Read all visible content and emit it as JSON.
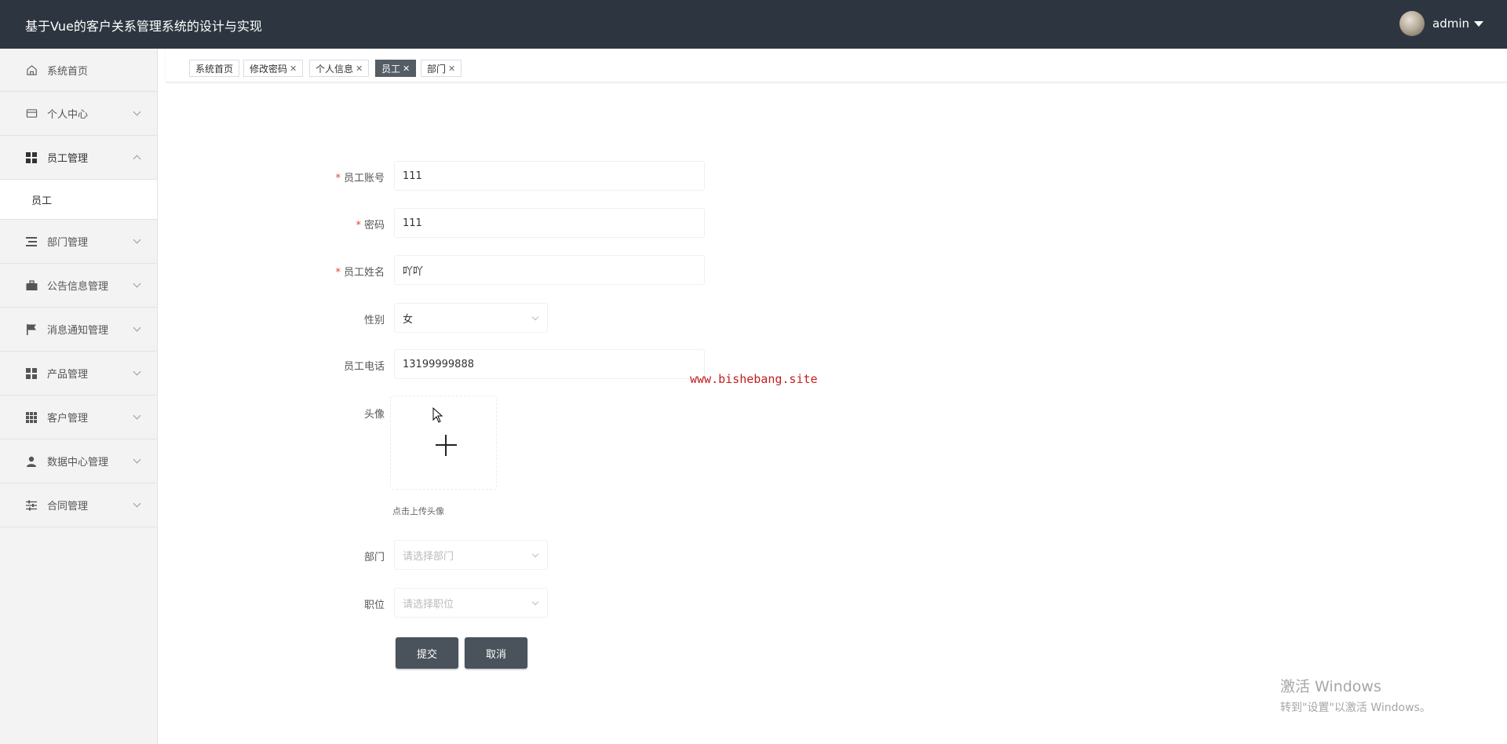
{
  "header": {
    "title": "基于Vue的客户关系管理系统的设计与实现",
    "username": "admin"
  },
  "sidebar": {
    "items": [
      {
        "label": "系统首页",
        "icon": "home-icon"
      },
      {
        "label": "个人中心",
        "icon": "wallet-icon"
      },
      {
        "label": "员工管理",
        "icon": "grid-icon",
        "expanded": true,
        "children": [
          "员工"
        ]
      },
      {
        "label": "部门管理",
        "icon": "list-icon"
      },
      {
        "label": "公告信息管理",
        "icon": "briefcase-icon"
      },
      {
        "label": "消息通知管理",
        "icon": "flag-icon"
      },
      {
        "label": "产品管理",
        "icon": "grid-icon"
      },
      {
        "label": "客户管理",
        "icon": "apps-icon"
      },
      {
        "label": "数据中心管理",
        "icon": "user-icon"
      },
      {
        "label": "合同管理",
        "icon": "sliders-icon"
      }
    ],
    "sub_item": "员工"
  },
  "tabs": [
    {
      "label": "系统首页",
      "closable": false,
      "active": false
    },
    {
      "label": "修改密码",
      "closable": true,
      "active": false
    },
    {
      "label": "个人信息",
      "closable": true,
      "active": false
    },
    {
      "label": "员工",
      "closable": true,
      "active": true
    },
    {
      "label": "部门",
      "closable": true,
      "active": false
    }
  ],
  "form": {
    "account_label": "员工账号",
    "account_value": "111",
    "password_label": "密码",
    "password_value": "111",
    "name_label": "员工姓名",
    "name_value": "吖吖",
    "gender_label": "性别",
    "gender_value": "女",
    "phone_label": "员工电话",
    "phone_value": "13199999888",
    "avatar_label": "头像",
    "upload_hint": "点击上传头像",
    "dept_label": "部门",
    "dept_placeholder": "请选择部门",
    "position_label": "职位",
    "position_placeholder": "请选择职位",
    "required_mark": "*",
    "submit_label": "提交",
    "cancel_label": "取消"
  },
  "overlay": {
    "watermark": "www.bishebang.site",
    "activate_line1": "激活 Windows",
    "activate_line2": "转到\"设置\"以激活 Windows。"
  },
  "colors": {
    "header_bg": "#2d3640",
    "active_tab": "#545c64",
    "button": "#4a535b",
    "required": "#e0443c",
    "watermark": "#c41d1d"
  }
}
